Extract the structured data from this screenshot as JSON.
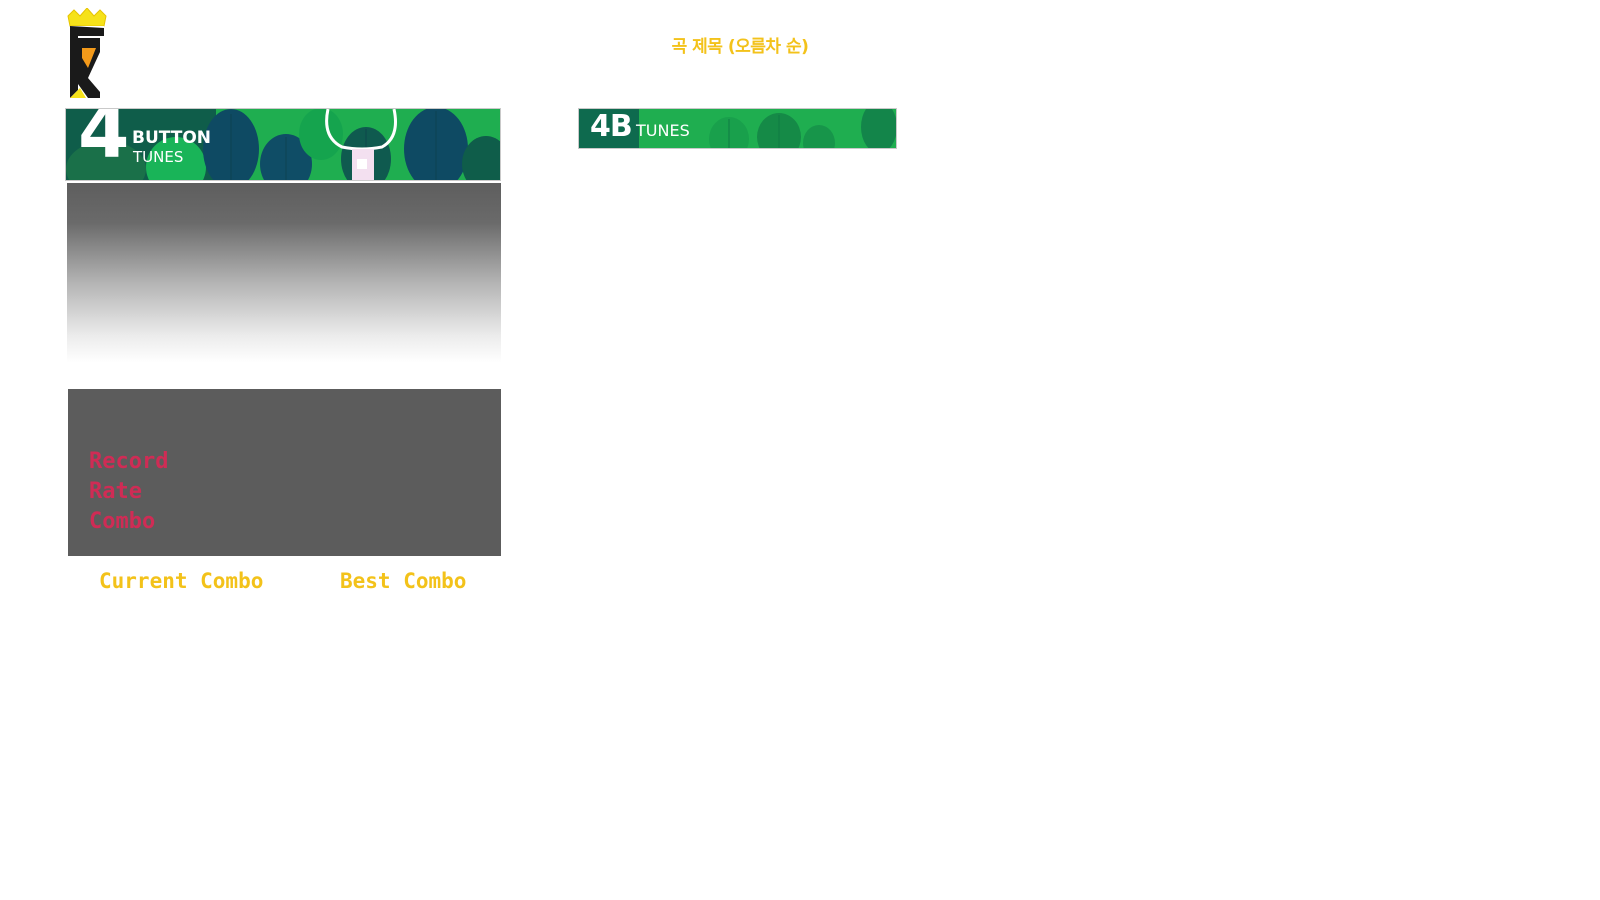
{
  "header": {
    "logo_icon": "dj-crown-logo-icon",
    "sort_label": "곡 제목 (오름차 순)"
  },
  "banner_main": {
    "number": "4",
    "button_word": "BUTTON",
    "tunes_word": "TUNES"
  },
  "banner_small": {
    "tag": "4B",
    "tunes_word": "TUNES"
  },
  "record_panel": {
    "record_label": "Record",
    "rate_label": "Rate",
    "combo_label": "Combo"
  },
  "combo_footer": {
    "current_label": "Current Combo",
    "best_label": "Best Combo"
  },
  "colors": {
    "accent_yellow": "#f3c21a",
    "record_red": "#cf2c55",
    "banner_green": "#1c9a4a",
    "panel_gray": "#5c5c5c"
  }
}
